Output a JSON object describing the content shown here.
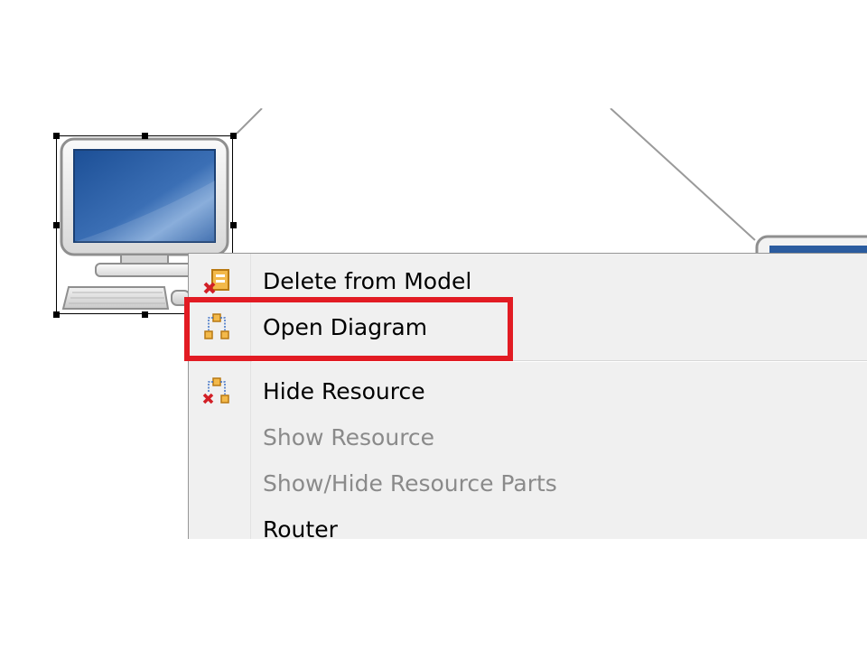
{
  "diagram": {
    "nodes": [
      {
        "name": "computer-node",
        "selected": true
      },
      {
        "name": "network-node",
        "selected": false
      }
    ]
  },
  "context_menu": {
    "items": [
      {
        "label": "Delete from Model",
        "icon": "delete-from-model-icon",
        "enabled": true
      },
      {
        "label": "Open Diagram",
        "icon": "open-diagram-icon",
        "enabled": true,
        "highlighted": true
      },
      {
        "label": "Hide Resource",
        "icon": "hide-resource-icon",
        "enabled": true
      },
      {
        "label": "Show Resource",
        "icon": null,
        "enabled": false
      },
      {
        "label": "Show/Hide Resource Parts",
        "icon": null,
        "enabled": false
      },
      {
        "label": "Router",
        "icon": null,
        "enabled": true
      }
    ]
  },
  "colors": {
    "highlight": "#e21b23",
    "menu_background": "#f0f0f0",
    "disabled_text": "#8a8a8a"
  }
}
